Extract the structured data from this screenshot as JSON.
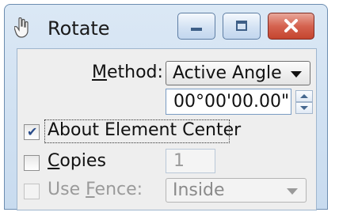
{
  "window": {
    "title": "Rotate"
  },
  "method": {
    "label": "Method:",
    "value": "Active Angle"
  },
  "angle": {
    "value": "00°00'00.00\""
  },
  "about_center": {
    "label": "About Element Center",
    "checked": true
  },
  "copies": {
    "label": "Copies",
    "value": "1",
    "checked": false
  },
  "use_fence": {
    "label": "Use Fence:",
    "value": "Inside",
    "checked": false
  },
  "colors": {
    "panel": "#eeeeee",
    "close": "#c4452f",
    "border": "#6c8db0"
  }
}
